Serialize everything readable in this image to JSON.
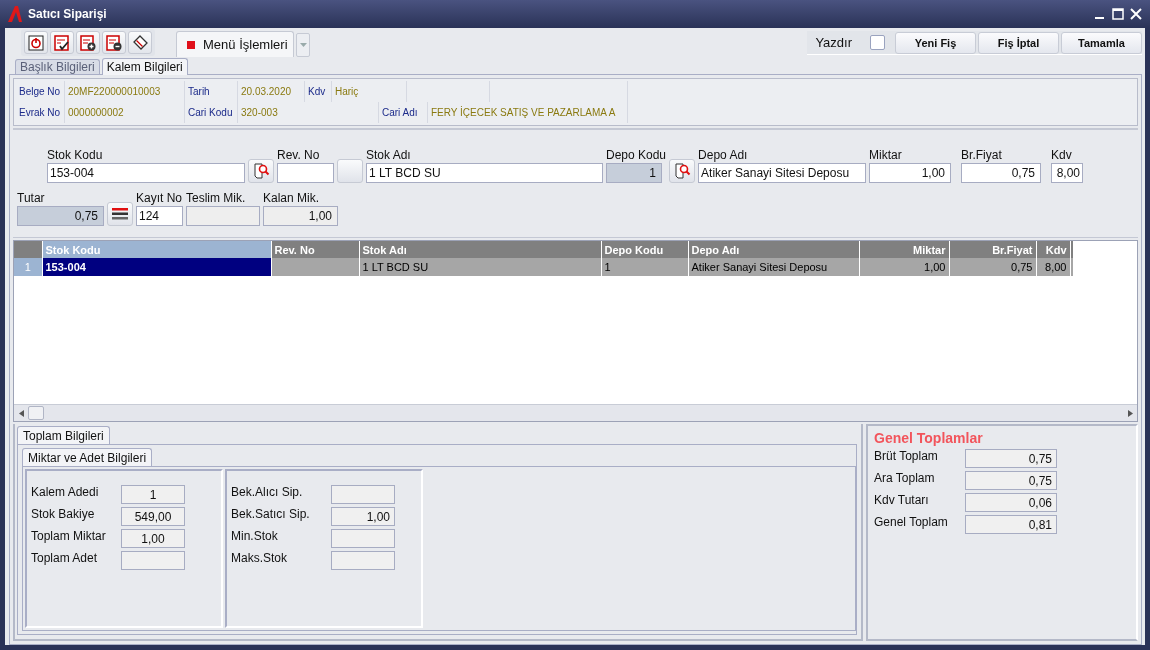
{
  "window": {
    "title": "Satıcı Siparişi"
  },
  "toolbar": {
    "menu_button": "Menü İşlemleri",
    "print": {
      "label": "Yazdır",
      "checked": false
    },
    "buttons": [
      "Yeni Fiş",
      "Fiş İptal",
      "Tamamla"
    ]
  },
  "tabs": [
    {
      "label": "Başlık Bilgileri",
      "selected": false
    },
    {
      "label": "Kalem Bilgileri",
      "selected": true
    }
  ],
  "header": [
    [
      {
        "kind": "label",
        "text": "Belge No"
      },
      {
        "kind": "value",
        "text": "20MF220000010003"
      },
      {
        "kind": "label",
        "text": "Tarih"
      },
      {
        "kind": "value",
        "text": "20.03.2020"
      },
      {
        "kind": "label",
        "text": "Kdv"
      },
      {
        "kind": "value",
        "text": "Hariç"
      },
      {
        "kind": "empty"
      },
      {
        "kind": "empty"
      }
    ],
    [
      {
        "kind": "label",
        "text": "Evrak No"
      },
      {
        "kind": "value",
        "text": "0000000002"
      },
      {
        "kind": "label",
        "text": "Cari Kodu"
      },
      {
        "kind": "value",
        "text": "320-003"
      },
      {
        "kind": "label",
        "text": "Cari Adı"
      },
      {
        "kind": "value",
        "text": "FERY İÇECEK SATIŞ VE PAZARLAMA A"
      }
    ]
  ],
  "form": [
    [
      {
        "kind": "field",
        "label": "Stok Kodu",
        "value": "153-004",
        "numeric": false
      },
      {
        "kind": "lookup"
      },
      {
        "kind": "field",
        "label": "Rev. No"
      },
      {
        "kind": "blank"
      },
      {
        "kind": "field",
        "label": "Stok Adı",
        "value": "1 LT BCD SU",
        "numeric": false
      },
      {
        "kind": "locked",
        "label": "Depo Kodu",
        "value": "1",
        "numeric": true
      },
      {
        "kind": "lookup"
      },
      {
        "kind": "field",
        "label": "Depo Adı",
        "value": "Atiker Sanayi Sitesi Deposu",
        "numeric": false
      },
      {
        "kind": "field",
        "label": "Miktar",
        "value": "1,00",
        "numeric": true
      },
      {
        "kind": "field",
        "label": "Br.Fiyat",
        "value": "0,75",
        "numeric": true
      },
      {
        "kind": "field",
        "label": "Kdv",
        "value": "8,00",
        "numeric": true
      }
    ],
    [
      {
        "kind": "locked",
        "label": "Tutar",
        "value": "0,75",
        "numeric": true
      },
      {
        "kind": "list"
      },
      {
        "kind": "field",
        "label": "Kayıt No",
        "value": "124",
        "numeric": false
      },
      {
        "kind": "readonly",
        "label": "Teslim Mik."
      },
      {
        "kind": "readonly",
        "label": "Kalan Mik.",
        "value": "1,00",
        "numeric": true
      }
    ]
  ],
  "grid": {
    "columns": [
      {
        "label": "Stok Kodu",
        "numeric": false
      },
      {
        "label": "Rev. No",
        "numeric": false
      },
      {
        "label": "Stok Adı",
        "numeric": false
      },
      {
        "label": "Depo Kodu",
        "numeric": false
      },
      {
        "label": "Depo Adı",
        "numeric": false
      },
      {
        "label": "Miktar",
        "numeric": true
      },
      {
        "label": "Br.Fiyat",
        "numeric": true
      },
      {
        "label": "Kdv",
        "numeric": true
      }
    ],
    "rows": [
      {
        "number": "1",
        "selected": true,
        "cells": [
          {
            "text": "153-004",
            "focused": true
          },
          {
            "focused": false
          },
          {
            "text": "1 LT BCD SU",
            "focused": false
          },
          {
            "text": "1",
            "focused": false
          },
          {
            "text": "Atiker Sanayi Sitesi Deposu",
            "focused": false
          },
          {
            "text": "1,00",
            "focused": false
          },
          {
            "text": "0,75",
            "focused": false
          },
          {
            "text": "8,00",
            "focused": false
          }
        ]
      }
    ]
  },
  "totals": {
    "tab": "Toplam Bilgileri",
    "subtab": "Miktar ve Adet Bilgileri",
    "groups": [
      [
        {
          "label": "Kalem Adedi",
          "value": "1"
        },
        {
          "label": "Stok Bakiye",
          "value": "549,00"
        },
        {
          "label": "Toplam Miktar",
          "value": "1,00"
        },
        {
          "label": "Toplam Adet"
        }
      ],
      [
        {
          "label": "Bek.Alıcı Sip."
        },
        {
          "label": "Bek.Satıcı Sip.",
          "value": "1,00"
        },
        {
          "label": "Min.Stok"
        },
        {
          "label": "Maks.Stok"
        }
      ]
    ]
  },
  "grand_totals": {
    "title": "Genel Toplamlar",
    "items": [
      {
        "label": "Brüt Toplam",
        "value": "0,75"
      },
      {
        "label": "Ara Toplam",
        "value": "0,75"
      },
      {
        "label": "Kdv Tutarı",
        "value": "0,06"
      },
      {
        "label": "Genel Toplam",
        "value": "0,81"
      }
    ]
  }
}
